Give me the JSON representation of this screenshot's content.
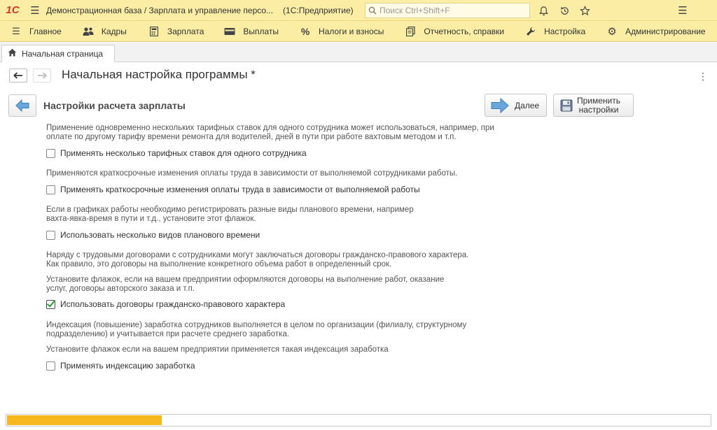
{
  "app": {
    "logo_text": "1С",
    "title": "Демонстрационная база / Зарплата и управление персо...",
    "platform": "(1С:Предприятие)",
    "search_placeholder": "Поиск Ctrl+Shift+F"
  },
  "sections": [
    {
      "label": "Главное",
      "icon": "menu-icon"
    },
    {
      "label": "Кадры",
      "icon": "people-icon"
    },
    {
      "label": "Зарплата",
      "icon": "calculator-icon"
    },
    {
      "label": "Выплаты",
      "icon": "wallet-icon"
    },
    {
      "label": "Налоги и взносы",
      "icon": "percent-icon"
    },
    {
      "label": "Отчетность, справки",
      "icon": "documents-icon"
    },
    {
      "label": "Настройка",
      "icon": "wrench-icon"
    },
    {
      "label": "Администрирование",
      "icon": "gear-icon"
    }
  ],
  "tabs": [
    {
      "label": "Начальная страница",
      "icon": "home-icon"
    }
  ],
  "form": {
    "title": "Начальная настройка программы *",
    "step_title": "Настройки расчета зарплаты",
    "next_label": "Далее",
    "apply_label_line1": "Применить",
    "apply_label_line2": "настройки"
  },
  "options": [
    {
      "desc1": "Применение одновременно нескольких тарифных ставок для одного сотрудника может использоваться, например, при",
      "desc2": "оплате по другому тарифу времени ремонта для водителей, дней в пути при работе вахтовым методом и т.п.",
      "label": "Применять несколько тарифных ставок для одного сотрудника",
      "checked": false
    },
    {
      "desc1": "Применяются краткосрочные изменения оплаты труда в зависимости от выполняемой сотрудниками работы.",
      "label": "Применять краткосрочные изменения оплаты труда в зависимости от выполняемой работы",
      "checked": false
    },
    {
      "desc1": "Если в графиках работы необходимо регистрировать разные виды планового времени, например",
      "desc2": "вахта-явка-время в пути и т.д., установите этот флажок.",
      "label": "Использовать несколько видов планового времени",
      "checked": false
    },
    {
      "desc1": "Наряду с трудовыми договорами с сотрудниками могут заключаться договоры гражданско-правового характера.",
      "desc2": "Как правило, это договоры на выполнение конкретного объема работ в определенный срок.",
      "desc3": "Установите флажок, если на вашем предприятии оформляются договоры на выполнение работ, оказание",
      "desc4": "услуг, договоры авторского заказа и т.п.",
      "label": "Использовать договоры гражданско-правового характера",
      "checked": true
    },
    {
      "desc1": "Индексация (повышение) заработка сотрудников выполняется в целом по организации (филиалу, структурному",
      "desc2": "подразделению) и учитывается при расчете среднего заработка.",
      "desc3": "Установите флажок если на вашем предприятии применяется такая индексация заработка",
      "label": "Применять индексацию заработка",
      "checked": false
    }
  ],
  "progress": {
    "value_fraction": 0.22
  },
  "colors": {
    "panel": "#fbeea4",
    "accent_blue": "#4a90d9",
    "check_green": "#2e9a3c",
    "progress": "#f5b91f"
  }
}
